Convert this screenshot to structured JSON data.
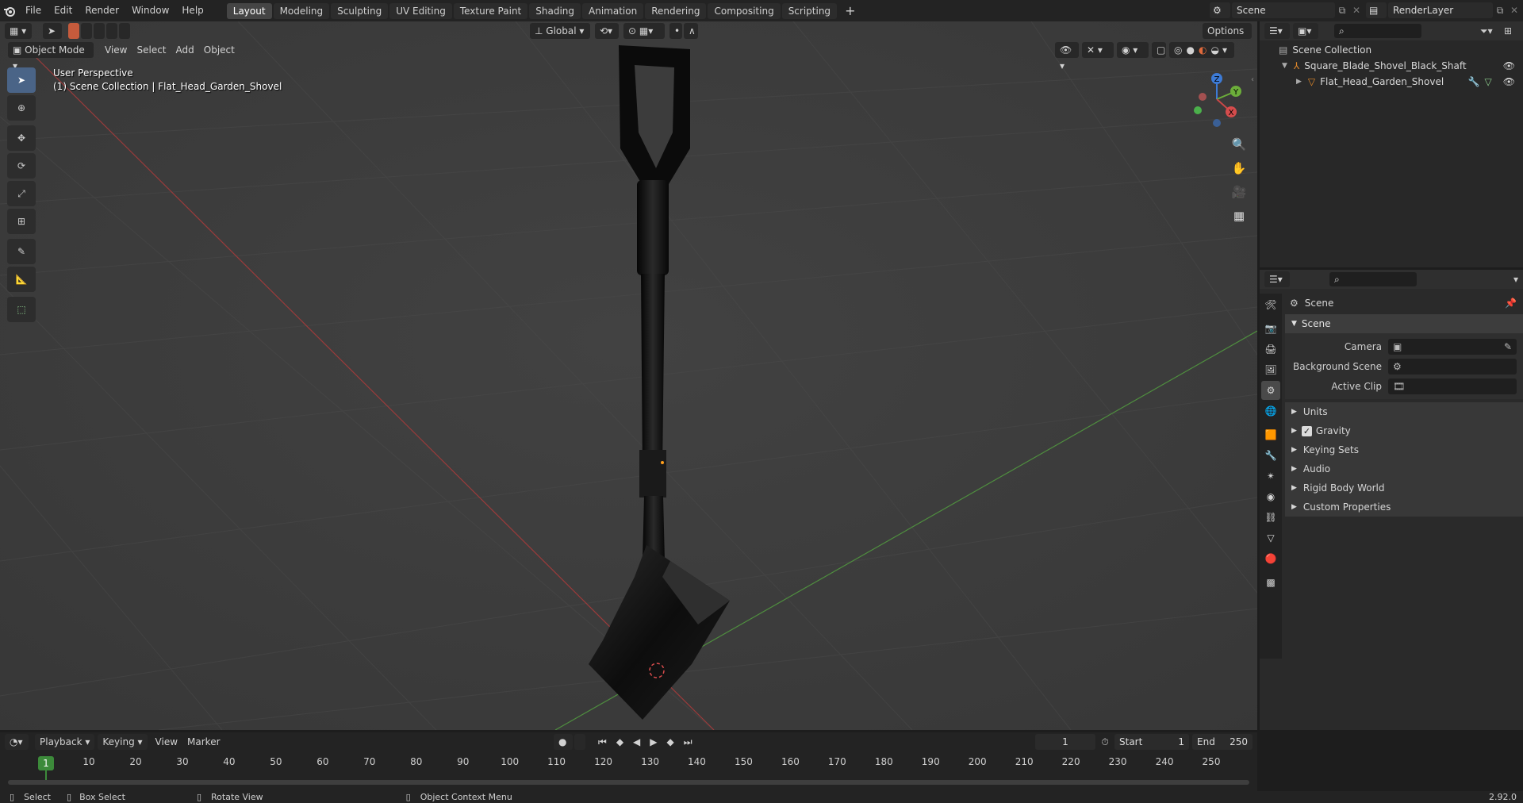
{
  "menu": [
    "File",
    "Edit",
    "Render",
    "Window",
    "Help"
  ],
  "workspaces": [
    "Layout",
    "Modeling",
    "Sculpting",
    "UV Editing",
    "Texture Paint",
    "Shading",
    "Animation",
    "Rendering",
    "Compositing",
    "Scripting"
  ],
  "active_workspace": "Layout",
  "scene_name": "Scene",
  "view_layer": "RenderLayer",
  "viewport": {
    "mode": "Object Mode",
    "menus": [
      "View",
      "Select",
      "Add",
      "Object"
    ],
    "transform_orientation": "Global",
    "options": "Options",
    "perspective_label": "User Perspective",
    "collection_label": "(1) Scene Collection | Flat_Head_Garden_Shovel",
    "gizmo": {
      "z": "Z",
      "y": "Y",
      "x": "X"
    }
  },
  "outliner": {
    "root": "Scene Collection",
    "items": [
      {
        "label": "Square_Blade_Shovel_Black_Shaft"
      },
      {
        "label": "Flat_Head_Garden_Shovel"
      }
    ]
  },
  "properties": {
    "context": "Scene",
    "panel_title": "Scene",
    "fields": {
      "camera": "Camera",
      "background_scene": "Background Scene",
      "active_clip": "Active Clip"
    },
    "sections": [
      "Units",
      "Gravity",
      "Keying Sets",
      "Audio",
      "Rigid Body World",
      "Custom Properties"
    ]
  },
  "timeline": {
    "menus": [
      "Playback",
      "Keying",
      "View",
      "Marker"
    ],
    "current_frame": "1",
    "start_label": "Start",
    "start": "1",
    "end_label": "End",
    "end": "250",
    "ticks": [
      "1",
      "10",
      "20",
      "30",
      "40",
      "50",
      "60",
      "70",
      "80",
      "90",
      "100",
      "110",
      "120",
      "130",
      "140",
      "150",
      "160",
      "170",
      "180",
      "190",
      "200",
      "210",
      "220",
      "230",
      "240",
      "250"
    ],
    "playhead": "1"
  },
  "statusbar": {
    "select": "Select",
    "box_select": "Box Select",
    "rotate_view": "Rotate View",
    "context_menu": "Object Context Menu",
    "version": "2.92.0"
  }
}
